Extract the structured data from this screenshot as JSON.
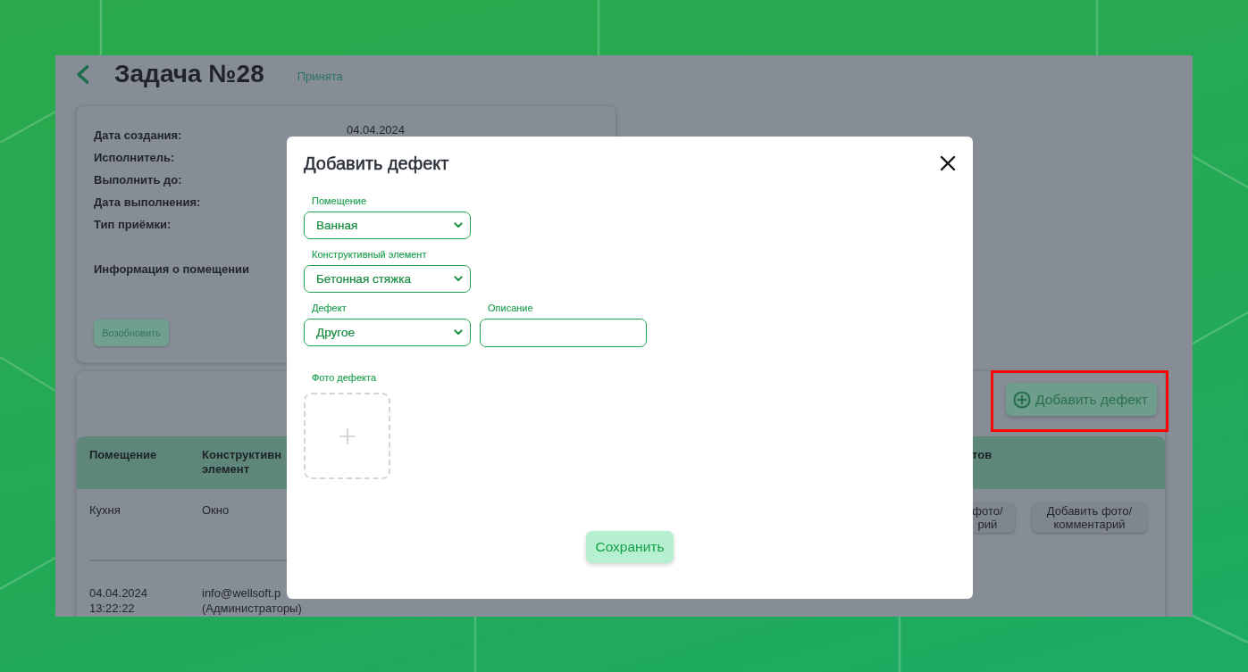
{
  "page": {
    "title": "Задача №28",
    "status": "Принята"
  },
  "task_info": {
    "rows": [
      {
        "label": "Дата создания:",
        "value": "04.04.2024"
      },
      {
        "label": "Исполнитель:"
      },
      {
        "label": "Выполнить до:"
      },
      {
        "label": "Дата выполнения:"
      },
      {
        "label": "Тип приёмки:"
      }
    ],
    "section_title": "Информация о помещении",
    "reopen_button": "Возобновить"
  },
  "defects": {
    "add_button": {
      "label": "Добавить дефект",
      "highlighted": true
    },
    "table": {
      "columns": [
        "Помещение",
        "Конструктивн элемент",
        "тов"
      ],
      "rows": [
        {
          "kind": "defect",
          "cells": [
            "Кухня",
            "Окно"
          ],
          "actions": [
            {
              "kind": "clipped",
              "label": "фото/ рий"
            },
            {
              "kind": "full",
              "label": "Добавить фото/ комментарий"
            }
          ]
        },
        {
          "kind": "history",
          "date": "04.04.2024",
          "time": "13:22:22",
          "author": "info@wellsoft.p",
          "author_group": "(Администраторы)"
        }
      ]
    }
  },
  "dialog": {
    "title": "Добавить дефект",
    "field_rows": [
      [
        {
          "kind": "select",
          "label": "Помещение",
          "value": "Ванная"
        }
      ],
      [
        {
          "kind": "select",
          "label": "Конструктивный элемент",
          "value": "Бетонная стяжка"
        }
      ],
      [
        {
          "kind": "select",
          "label": "Дефект",
          "value": "Другое"
        },
        {
          "kind": "text",
          "label": "Описание"
        }
      ]
    ],
    "photo": {
      "label": "Фото дефекта"
    },
    "save_button": "Сохранить"
  }
}
